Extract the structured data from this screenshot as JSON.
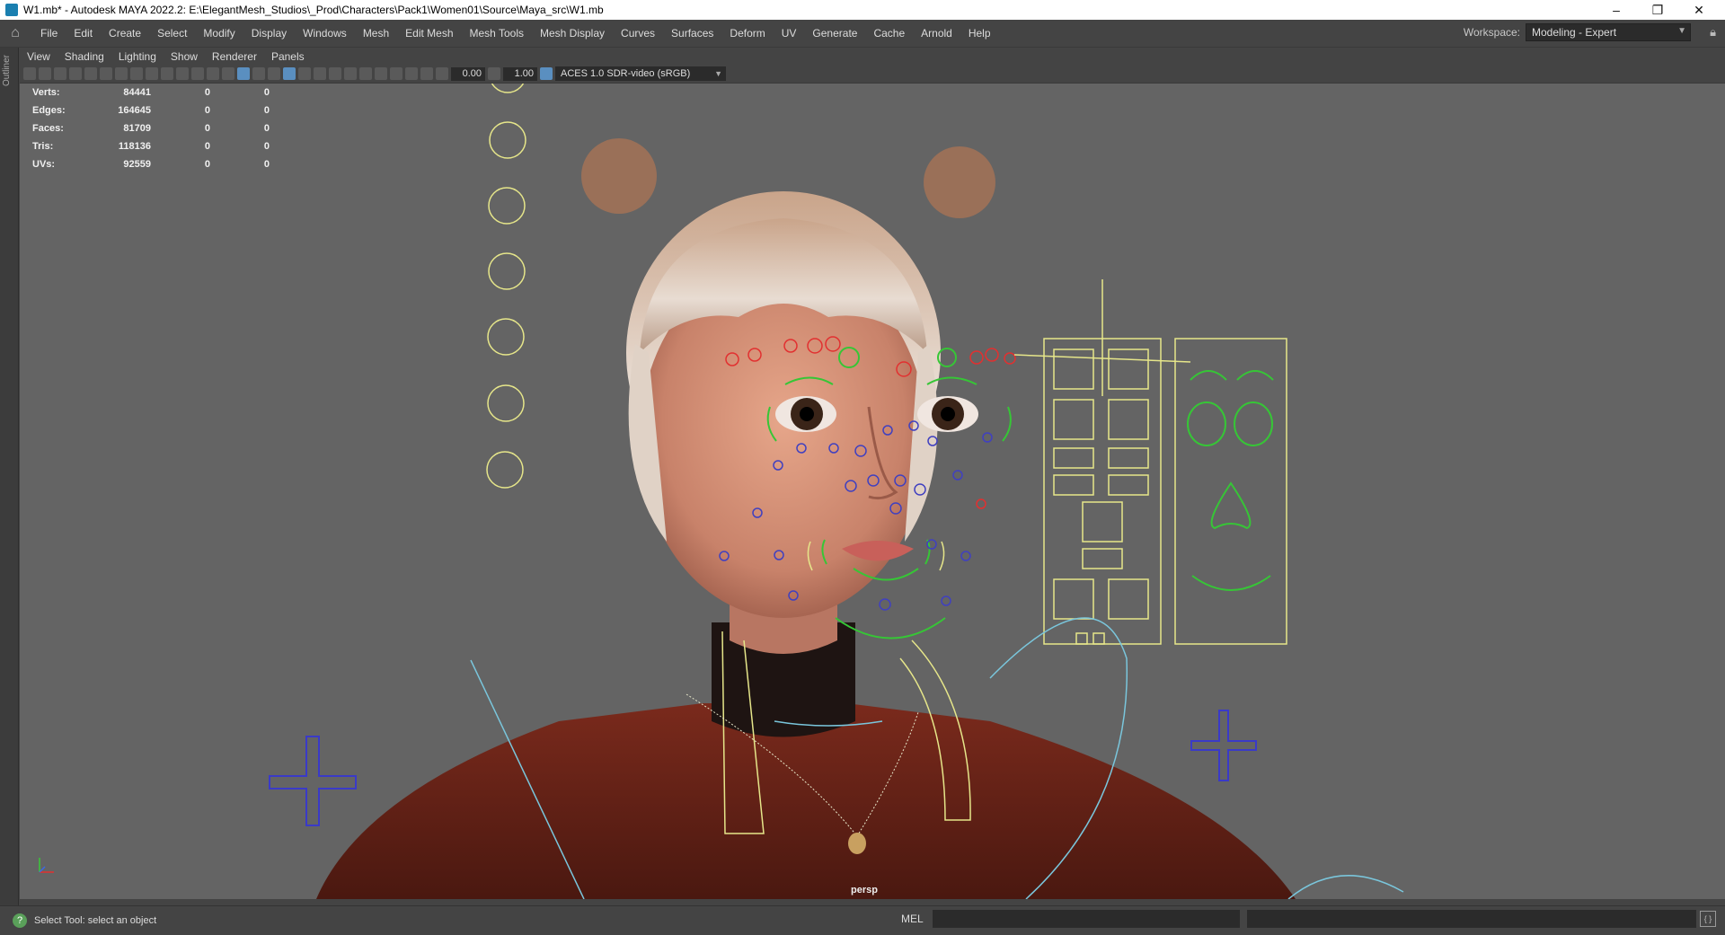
{
  "window": {
    "title": "W1.mb* - Autodesk MAYA 2022.2: E:\\ElegantMesh_Studios\\_Prod\\Characters\\Pack1\\Women01\\Source\\Maya_src\\W1.mb",
    "minimize": "–",
    "maximize": "❐",
    "close": "✕"
  },
  "menubar": {
    "items": [
      "File",
      "Edit",
      "Create",
      "Select",
      "Modify",
      "Display",
      "Windows",
      "Mesh",
      "Edit Mesh",
      "Mesh Tools",
      "Mesh Display",
      "Curves",
      "Surfaces",
      "Deform",
      "UV",
      "Generate",
      "Cache",
      "Arnold",
      "Help"
    ]
  },
  "workspace": {
    "label": "Workspace:",
    "value": "Modeling - Expert"
  },
  "outliner_tab": "Outliner",
  "panel_menu": {
    "items": [
      "View",
      "Shading",
      "Lighting",
      "Show",
      "Renderer",
      "Panels"
    ]
  },
  "toolbar": {
    "exposure": "0.00",
    "gamma": "1.00",
    "color_space": "ACES 1.0 SDR-video (sRGB)"
  },
  "hud": {
    "rows": [
      {
        "label": "Verts:",
        "value": "84441",
        "a": "0",
        "b": "0"
      },
      {
        "label": "Edges:",
        "value": "164645",
        "a": "0",
        "b": "0"
      },
      {
        "label": "Faces:",
        "value": "81709",
        "a": "0",
        "b": "0"
      },
      {
        "label": "Tris:",
        "value": "118136",
        "a": "0",
        "b": "0"
      },
      {
        "label": "UVs:",
        "value": "92559",
        "a": "0",
        "b": "0"
      }
    ]
  },
  "camera_label": "persp",
  "statusbar": {
    "help_text": "Select Tool: select an object",
    "mel_label": "MEL"
  },
  "colors": {
    "viewport_bg": "#646464",
    "ui_bg": "#444444",
    "control_yellow": "#e6e68a",
    "control_green": "#36c636",
    "control_red": "#e23030",
    "control_blue": "#4040c0",
    "control_cyan": "#7ac6dc",
    "sweater": "#6b2418"
  }
}
